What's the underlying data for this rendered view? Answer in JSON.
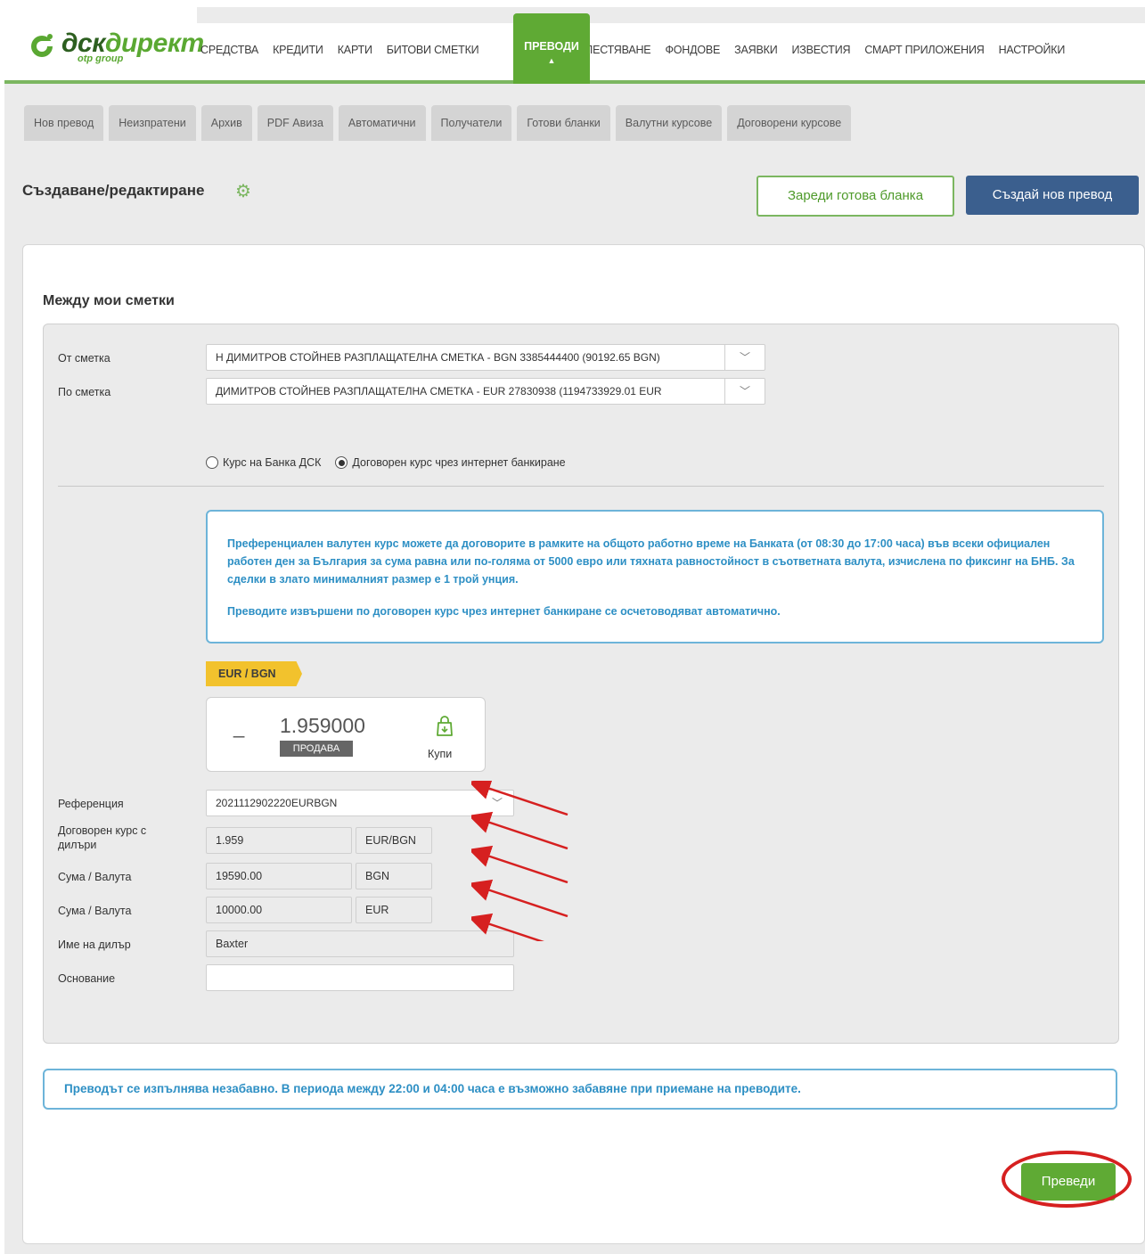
{
  "brand": {
    "logo_main": "дск",
    "logo_main_b": "директ",
    "logo_sub": "otp group",
    "color": "#5faa34"
  },
  "nav": {
    "items": [
      "СРЕДСТВА",
      "КРЕДИТИ",
      "КАРТИ",
      "БИТОВИ СМЕТКИ"
    ],
    "active": "ПРЕВОДИ",
    "items_after": [
      "СПЕСТЯВАНЕ",
      "ФОНДОВЕ",
      "ЗАЯВКИ",
      "ИЗВЕСТИЯ",
      "СМАРТ ПРИЛОЖЕНИЯ",
      "НАСТРОЙКИ"
    ]
  },
  "subtabs": [
    "Нов превод",
    "Неизпратени",
    "Архив",
    "PDF Авиза",
    "Автоматични",
    "Получатели",
    "Готови бланки",
    "Валутни курсове",
    "Договорени курсове"
  ],
  "header": {
    "title": "Създаване/редактиране",
    "load_template_label": "Зареди готова бланка",
    "new_transfer_label": "Създай нов превод"
  },
  "form": {
    "section_title": "Между мои сметки",
    "from_label": "От сметка",
    "from_value": "Н ДИМИТРОВ СТОЙНЕВ РАЗПЛАЩАТЕЛНА СМЕТКА - BGN 3385444400 (90192.65 BGN)",
    "to_label": "По сметка",
    "to_value": "ДИМИТРОВ СТОЙНЕВ РАЗПЛАЩАТЕЛНА СМЕТКА - EUR 27830938 (1194733929.01 EUR",
    "radio_bank_rate": "Курс на Банка ДСК",
    "radio_negotiated": "Договорен курс чрез интернет банкиране",
    "selected_radio": "negotiated",
    "info_p1": "Преференциален валутен курс можете да договорите в рамките на общото работно време на Банката (от 08:30 до 17:00 часа) във всеки официален работен ден за България за сума равна или по-голяма от 5000 евро или тяхната равностойност в съответната валута, изчислена по фиксинг на БНБ. За сделки в злато минималният размер е 1 трой унция.",
    "info_p2": "Преводите извършени по договорен курс чрез интернет банкиране се осчетоводяват автоматично.",
    "pair_tag": "EUR / BGN",
    "rate_dash": "_",
    "rate_value": "1.959000",
    "rate_badge": "ПРОДАВА",
    "buy_label": "Купи",
    "reference_label": "Референция",
    "reference_value": "2021112902220EURBGN",
    "dealer_rate_label_1": "Договорен курс с",
    "dealer_rate_label_2": "дилъри",
    "dealer_rate_value": "1.959",
    "dealer_rate_unit": "EUR/BGN",
    "amount1_label": "Сума / Валута",
    "amount1_value": "19590.00",
    "amount1_currency": "BGN",
    "amount2_label": "Сума / Валута",
    "amount2_value": "10000.00",
    "amount2_currency": "EUR",
    "dealer_name_label": "Име на дилър",
    "dealer_name_value": "Baxter",
    "basis_label": "Основание",
    "basis_value": ""
  },
  "notice": "Преводът се изпълнява незабавно. В периода между 22:00 и 04:00 часа е възможно забавяне при приемане на преводите.",
  "submit_label": "Преведи",
  "annotation_color": "#d62020",
  "info_color": "#2d8fc4"
}
